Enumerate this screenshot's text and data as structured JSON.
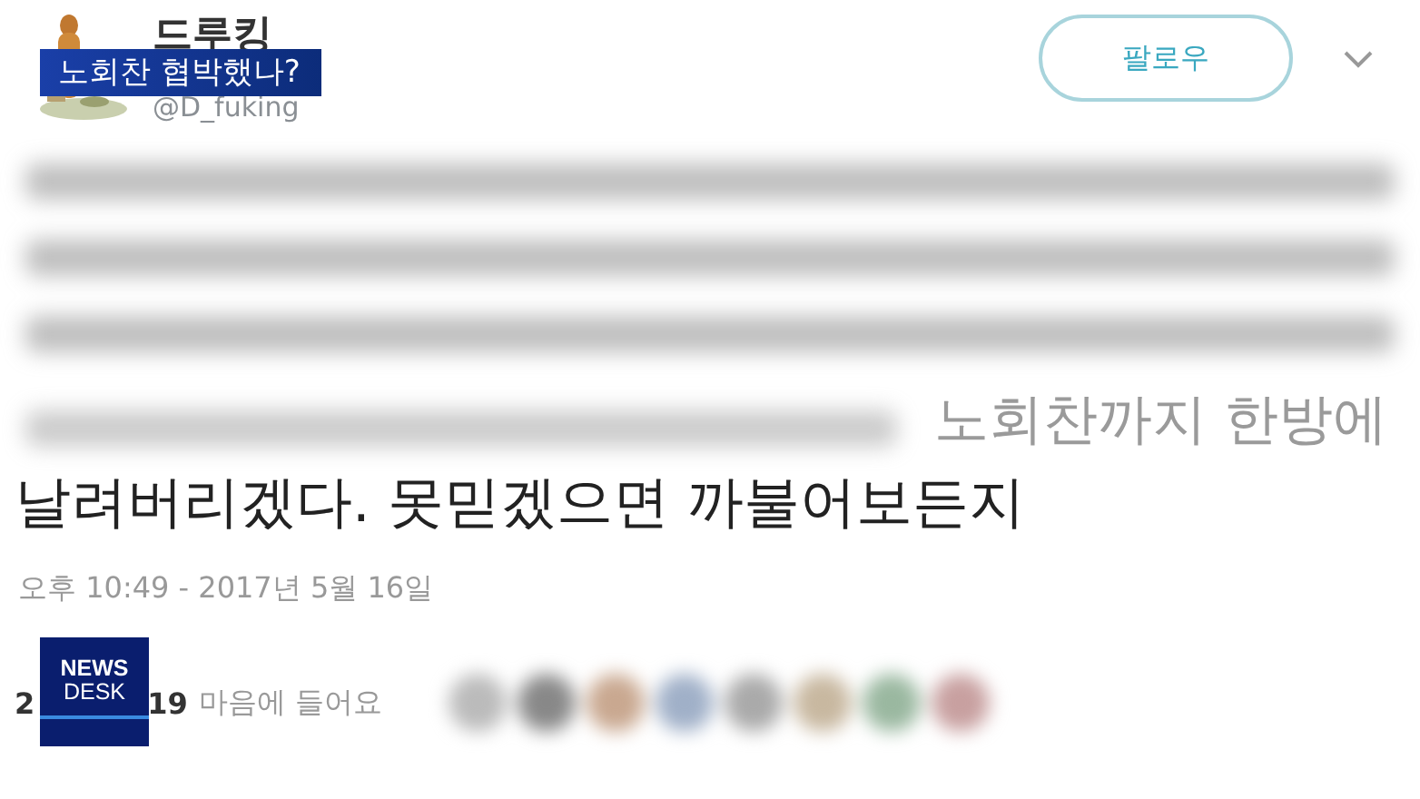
{
  "tweet": {
    "name": "드루킹",
    "handle": "@D_fuking",
    "follow_button": "팔로우",
    "text_partial": "노회찬까지 한방에",
    "text_line": "날려버리겠다. 못믿겠으면 까불어보든지",
    "timestamp": "오후 10:49 - 2017년 5월 16일",
    "retweets_count": "2",
    "likes_count": "19",
    "likes_label": "마음에 들어요"
  },
  "broadcast": {
    "caption": "노회찬 협박했나?",
    "logo_top": "NEWS",
    "logo_bottom": "DESK"
  }
}
